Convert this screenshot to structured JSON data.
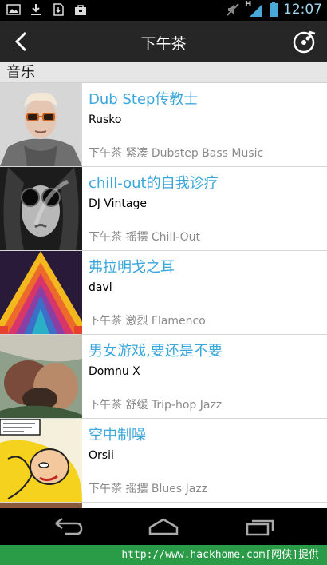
{
  "status_bar": {
    "time": "12:07",
    "network_label": "H",
    "icons": [
      "picture-icon",
      "download-icon",
      "sd-card-icon",
      "bag-icon",
      "mute-icon",
      "signal-icon",
      "battery-icon"
    ]
  },
  "header": {
    "title": "下午茶",
    "back_icon": "back-arrow-icon",
    "music_icon": "music-disc-icon"
  },
  "section": {
    "label": "音乐"
  },
  "tracks": [
    {
      "title": "Dub Step传教士",
      "artist": "Rusko",
      "tags": "下午茶 紧凑 Dubstep Bass Music"
    },
    {
      "title": "chill-out的自我诊疗",
      "artist": "DJ Vintage",
      "tags": "下午茶 摇摆 Chill-Out"
    },
    {
      "title": "弗拉明戈之耳",
      "artist": "davl",
      "tags": "下午茶 激烈 Flamenco"
    },
    {
      "title": "男女游戏,要还是不要",
      "artist": "Domnu X",
      "tags": "下午茶 舒缓 Trip-hop Jazz"
    },
    {
      "title": "空中制噪",
      "artist": "Orsii",
      "tags": "下午茶 摇摆 Blues Jazz"
    }
  ],
  "nav": {
    "icons": [
      "back-nav-icon",
      "home-nav-icon",
      "recent-apps-icon"
    ]
  },
  "footer": {
    "text": "http://www.hackhome.com[网侠]提供"
  },
  "colors": {
    "accent": "#3aa7dc",
    "header_bg": "#262626",
    "footer_bg": "#2a9c48"
  }
}
